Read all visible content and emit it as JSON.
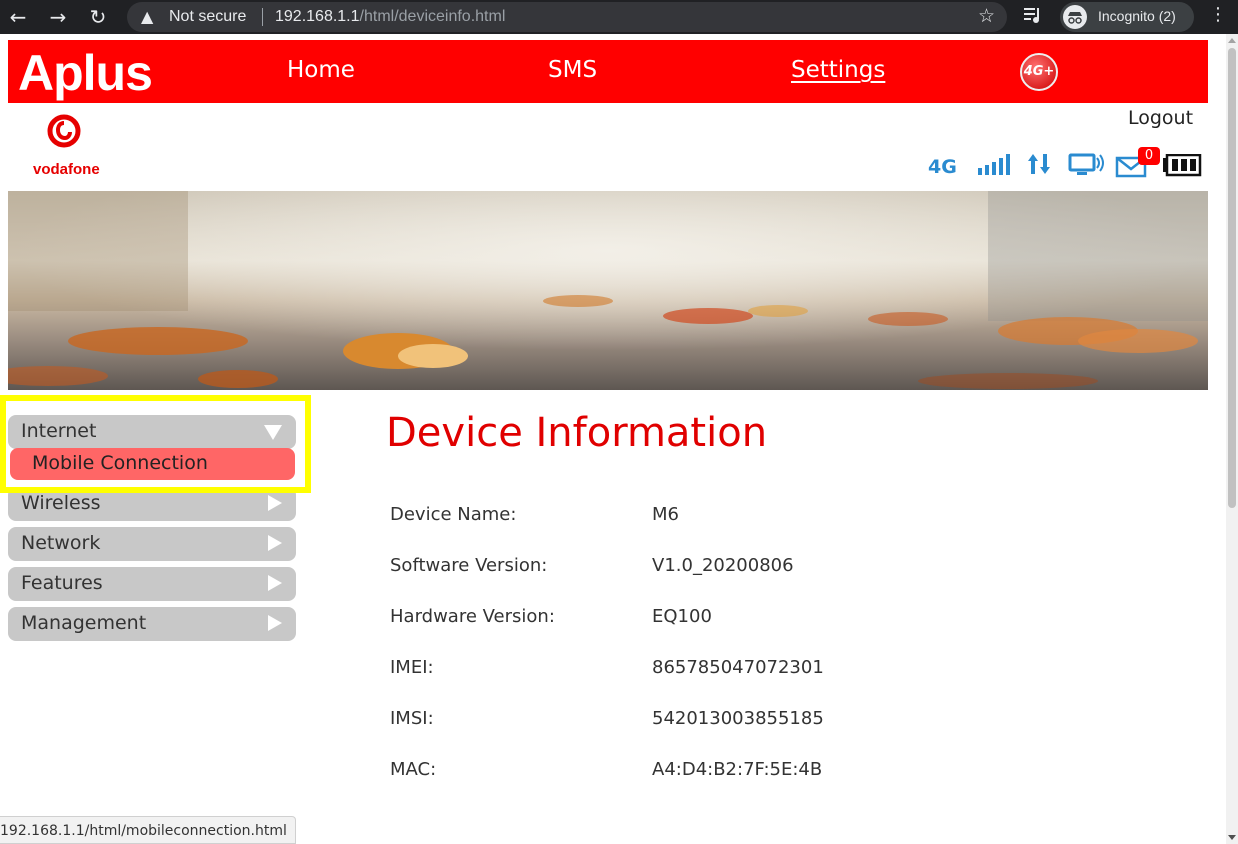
{
  "browser": {
    "security_label": "Not secure",
    "url_host": "192.168.1.1",
    "url_path": "/html/deviceinfo.html",
    "profile_label": "Incognito (2)",
    "hover_url": "192.168.1.1/html/mobileconnection.html"
  },
  "header": {
    "brand": "Aplus",
    "nav": [
      {
        "label": "Home"
      },
      {
        "label": "SMS"
      },
      {
        "label": "Settings",
        "active": true
      }
    ],
    "badge": "4G+",
    "logout": "Logout",
    "logo_text": "vodafone",
    "network_type": "4G",
    "sms_count": "0"
  },
  "sidebar": {
    "items": [
      {
        "label": "Internet",
        "expanded": true
      },
      {
        "label": "Wireless"
      },
      {
        "label": "Network"
      },
      {
        "label": "Features"
      },
      {
        "label": "Management"
      }
    ],
    "submenu": [
      {
        "label": "Mobile Connection"
      }
    ]
  },
  "main": {
    "title": "Device Information",
    "rows": [
      {
        "label": "Device Name:",
        "value": "M6"
      },
      {
        "label": "Software Version:",
        "value": "V1.0_20200806"
      },
      {
        "label": "Hardware Version:",
        "value": "EQ100"
      },
      {
        "label": "IMEI:",
        "value": "865785047072301"
      },
      {
        "label": "IMSI:",
        "value": "542013003855185"
      },
      {
        "label": "MAC:",
        "value": "A4:D4:B2:7F:5E:4B"
      }
    ]
  },
  "colors": {
    "brand_red": "#ff0000",
    "title_red": "#e00000",
    "submenu_active": "#ff6666",
    "highlight": "#ffff00",
    "status_blue": "#2a8bd0"
  }
}
